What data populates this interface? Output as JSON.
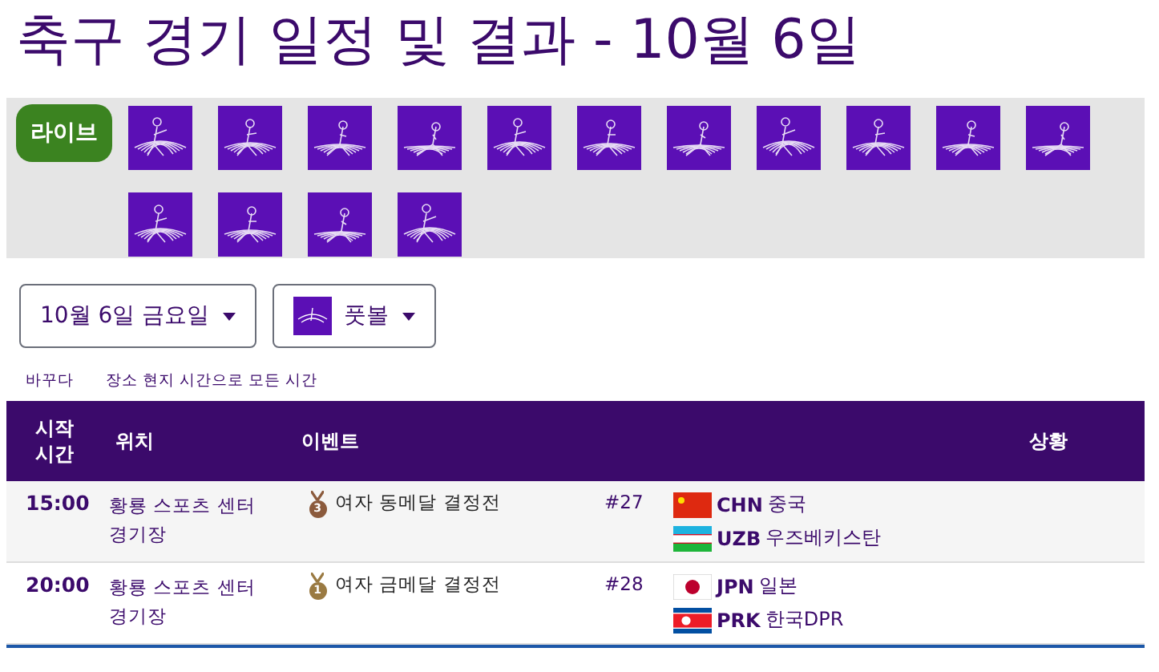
{
  "title": "축구 경기 일정 및 결과 - 10월 6일",
  "live_button": "라이브",
  "date_dropdown": "10월 6일 금요일",
  "sport_dropdown": "풋볼",
  "links": [
    "바꾸다",
    "장소 현지 시간으로 모든 시간"
  ],
  "table": {
    "columns": [
      "시작 시간",
      "위치",
      "이벤트",
      "상황"
    ],
    "rows": [
      {
        "time": "15:00",
        "location": "황룡 스포츠 센터 경기장",
        "medal": {
          "kind": "bronze",
          "rank": "3"
        },
        "event": "여자 동메달 결정전",
        "number": "#27",
        "teams": [
          {
            "kind": "china",
            "code": "CHN",
            "name": "중국"
          },
          {
            "kind": "uzbekistan",
            "code": "UZB",
            "name": "우즈베키스탄"
          }
        ]
      },
      {
        "time": "20:00",
        "location": "황룡 스포츠 센터 경기장",
        "medal": {
          "kind": "gold",
          "rank": "1"
        },
        "event": "여자 금메달 결정전",
        "number": "#28",
        "teams": [
          {
            "kind": "japan",
            "code": "JPN",
            "name": "일본"
          },
          {
            "kind": "north_korea",
            "code": "PRK",
            "name": "한국DPR"
          }
        ]
      }
    ]
  }
}
